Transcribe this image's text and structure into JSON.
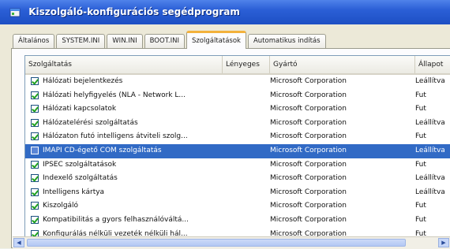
{
  "window": {
    "title": "Kiszolgáló-konfigurációs segédprogram"
  },
  "tabs": [
    {
      "label": "Általános"
    },
    {
      "label": "SYSTEM.INI"
    },
    {
      "label": "WIN.INI"
    },
    {
      "label": "BOOT.INI"
    },
    {
      "label": "Szolgáltatások"
    },
    {
      "label": "Automatikus indítás"
    }
  ],
  "active_tab": "Szolgáltatások",
  "table": {
    "columns": [
      "Szolgáltatás",
      "Lényeges",
      "Gyártó",
      "Állapot"
    ],
    "rows": [
      {
        "name": "Hálózati bejelentkezés",
        "vendor": "Microsoft Corporation",
        "status": "Leállítva"
      },
      {
        "name": "Hálózati helyfigyelés (NLA - Network L...",
        "vendor": "Microsoft Corporation",
        "status": "Fut"
      },
      {
        "name": "Hálózati kapcsolatok",
        "vendor": "Microsoft Corporation",
        "status": "Fut"
      },
      {
        "name": "Hálózatelérési szolgáltatás",
        "vendor": "Microsoft Corporation",
        "status": "Leállítva"
      },
      {
        "name": "Hálózaton futó intelligens átviteli szolg...",
        "vendor": "Microsoft Corporation",
        "status": "Fut"
      },
      {
        "name": "IMAPI CD-égető COM szolgáltatás",
        "vendor": "Microsoft Corporation",
        "status": "Leállítva",
        "selected": true
      },
      {
        "name": "IPSEC szolgáltatások",
        "vendor": "Microsoft Corporation",
        "status": "Fut"
      },
      {
        "name": "Indexelő szolgáltatás",
        "vendor": "Microsoft Corporation",
        "status": "Leállítva"
      },
      {
        "name": "Intelligens kártya",
        "vendor": "Microsoft Corporation",
        "status": "Leállítva"
      },
      {
        "name": "Kiszolgáló",
        "vendor": "Microsoft Corporation",
        "status": "Fut"
      },
      {
        "name": "Kompatibilitás a gyors felhasználóváltá...",
        "vendor": "Microsoft Corporation",
        "status": "Fut"
      },
      {
        "name": "Konfigurálás nélküli vezeték nélküli hál...",
        "vendor": "Microsoft Corporation",
        "status": "Fut"
      }
    ]
  },
  "colors": {
    "titlebar": "#2b5fd6",
    "selection": "#316ac5",
    "active_tab_accent": "#f3b23c"
  },
  "icons": [
    "app-icon",
    "checkbox-checked-icon",
    "scroll-left-icon",
    "scroll-right-icon"
  ]
}
